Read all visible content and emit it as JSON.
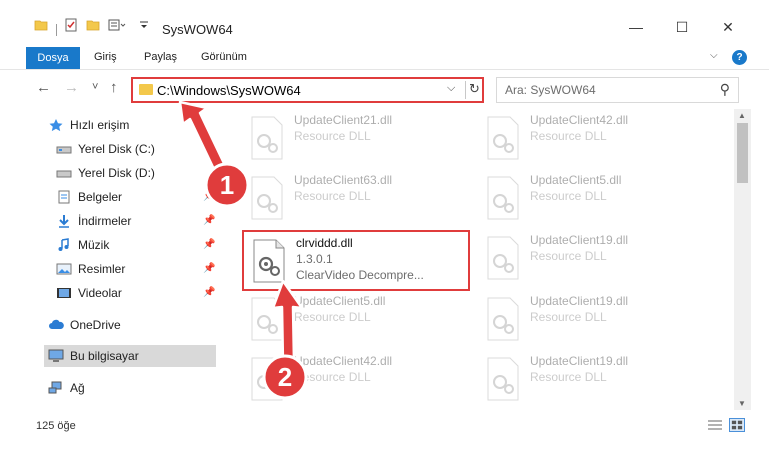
{
  "window": {
    "title": "SysWOW64",
    "minimize_glyph": "—",
    "maximize_glyph": "☐",
    "close_glyph": "✕"
  },
  "ribbon": {
    "file_tab": "Dosya",
    "tabs": [
      "Giriş",
      "Paylaş",
      "Görünüm"
    ],
    "help_glyph": "?"
  },
  "navbar": {
    "back_glyph": "←",
    "forward_glyph": "→",
    "recent_glyph": "˅",
    "up_glyph": "↑",
    "address": "C:\\Windows\\SysWOW64",
    "search_placeholder": "Ara: SysWOW64"
  },
  "sidebar": {
    "items": [
      {
        "label": "Hızlı erişim",
        "icon": "star-icon"
      },
      {
        "label": "Yerel Disk (C:)",
        "icon": "drive-icon"
      },
      {
        "label": "Yerel Disk (D:)",
        "icon": "drive-icon"
      },
      {
        "label": "Belgeler",
        "icon": "documents-icon"
      },
      {
        "label": "İndirmeler",
        "icon": "downloads-icon"
      },
      {
        "label": "Müzik",
        "icon": "music-icon"
      },
      {
        "label": "Resimler",
        "icon": "pictures-icon"
      },
      {
        "label": "Videolar",
        "icon": "videos-icon"
      },
      {
        "label": "OneDrive",
        "icon": "cloud-icon"
      },
      {
        "label": "Bu bilgisayar",
        "icon": "computer-icon"
      },
      {
        "label": "Ağ",
        "icon": "network-icon"
      }
    ]
  },
  "files": [
    {
      "name": "UpdateClient21.dll",
      "line2": "Resource DLL",
      "line3": ""
    },
    {
      "name": "UpdateClient42.dll",
      "line2": "Resource DLL",
      "line3": ""
    },
    {
      "name": "UpdateClient63.dll",
      "line2": "Resource DLL",
      "line3": ""
    },
    {
      "name": "UpdateClient5.dll",
      "line2": "Resource DLL",
      "line3": ""
    },
    {
      "name": "clrviddd.dll",
      "line2": "1.3.0.1",
      "line3": "ClearVideo Decompre..."
    },
    {
      "name": "UpdateClient19.dll",
      "line2": "Resource DLL",
      "line3": ""
    },
    {
      "name": "UpdateClient5.dll",
      "line2": "Resource DLL",
      "line3": ""
    },
    {
      "name": "UpdateClient19.dll",
      "line2": "Resource DLL",
      "line3": ""
    },
    {
      "name": "UpdateClient42.dll",
      "line2": "Resource DLL",
      "line3": ""
    },
    {
      "name": "UpdateClient19.dll",
      "line2": "Resource DLL",
      "line3": ""
    }
  ],
  "status": {
    "item_count": "125 öğe"
  },
  "annotations": {
    "step1": "1",
    "step2": "2",
    "color": "#e03c3c"
  },
  "colors": {
    "accent": "#1979ca",
    "highlight": "#e03c3c",
    "folder": "#f3c84b"
  }
}
